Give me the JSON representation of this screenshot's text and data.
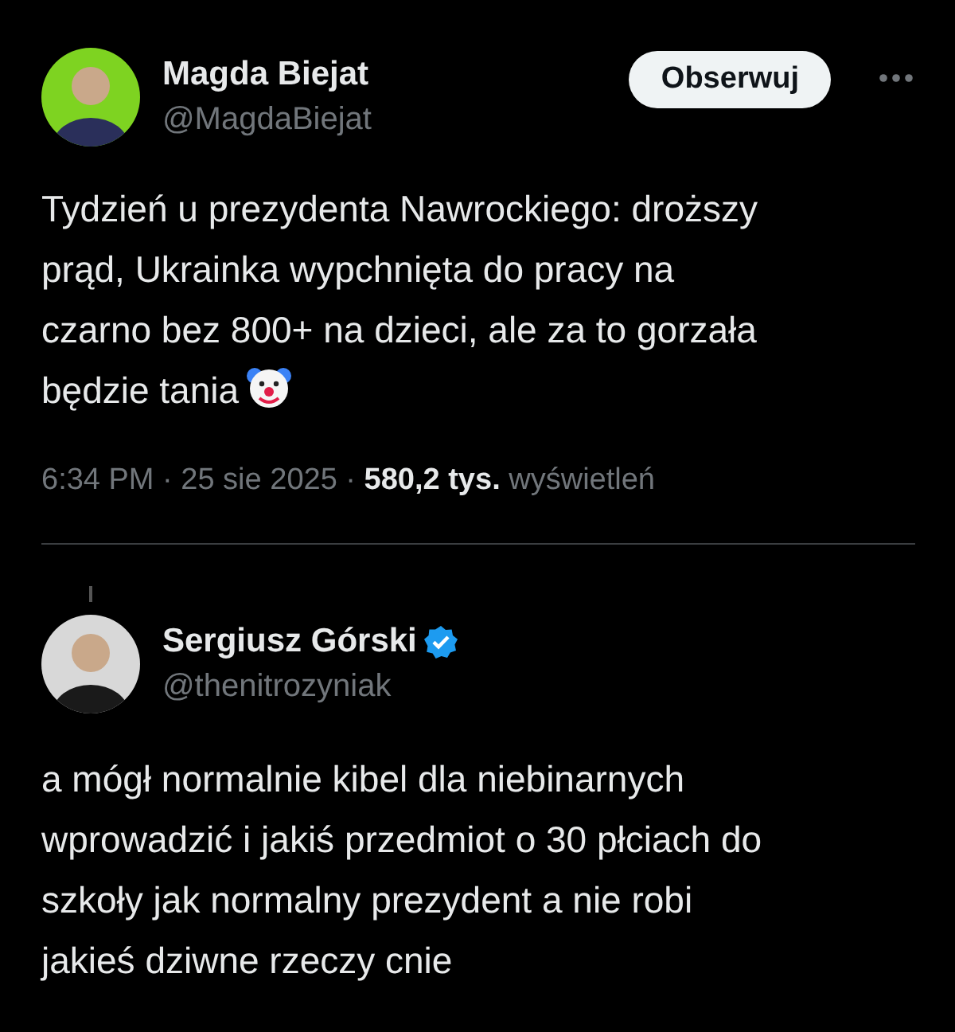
{
  "tweet": {
    "author": {
      "name": "Magda Biejat",
      "handle": "@MagdaBiejat"
    },
    "follow_button": "Obserwuj",
    "body_lines": [
      "Tydzień u prezydenta Nawrockiego: droższy",
      "prąd, Ukrainka wypchnięta do pracy na",
      "czarno bez 800+ na dzieci, ale za to gorzała",
      "będzie tania"
    ],
    "meta": "6:34 PM · 25 sie 2025 · **580,2 tys.** wyświetleń"
  },
  "reply": {
    "author": {
      "name": "Sergiusz Górski",
      "handle": "@thenitrozyniak",
      "verified": true
    },
    "body_lines": [
      "a mógł normalnie kibel dla niebinarnych",
      "wprowadzić i jakiś przedmiot o 30 płciach do",
      "szkoły jak normalny prezydent a nie robi",
      "jakieś dziwne rzeczy cnie"
    ]
  }
}
